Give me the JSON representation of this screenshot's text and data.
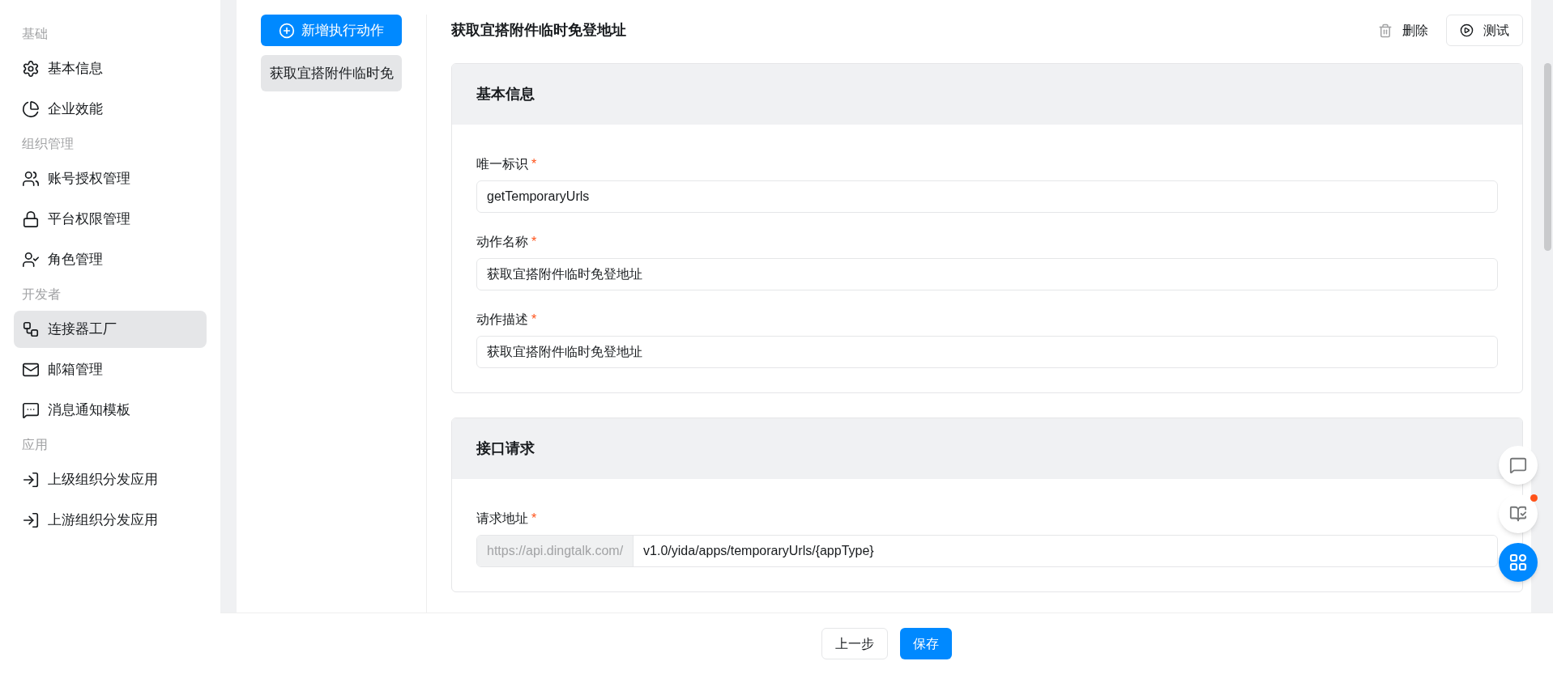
{
  "sidebar": {
    "groups": [
      {
        "heading": "基础",
        "items": [
          {
            "label": "基本信息",
            "selected": false
          },
          {
            "label": "企业效能",
            "selected": false
          }
        ]
      },
      {
        "heading": "组织管理",
        "items": [
          {
            "label": "账号授权管理",
            "selected": false
          },
          {
            "label": "平台权限管理",
            "selected": false
          },
          {
            "label": "角色管理",
            "selected": false
          }
        ]
      },
      {
        "heading": "开发者",
        "items": [
          {
            "label": "连接器工厂",
            "selected": true
          },
          {
            "label": "邮箱管理",
            "selected": false
          },
          {
            "label": "消息通知模板",
            "selected": false
          }
        ]
      },
      {
        "heading": "应用",
        "items": [
          {
            "label": "上级组织分发应用",
            "selected": false
          },
          {
            "label": "上游组织分发应用",
            "selected": false
          }
        ]
      }
    ]
  },
  "actions": {
    "add_button": "新增执行动作",
    "items": [
      {
        "label": "获取宜搭附件临时免",
        "selected": true
      }
    ]
  },
  "detail": {
    "title": "获取宜搭附件临时免登地址",
    "delete_button": "删除",
    "test_button": "测试",
    "sections": [
      {
        "title": "基本信息",
        "fields": [
          {
            "kind": "text",
            "label": "唯一标识",
            "required_mark": "*",
            "value": "getTemporaryUrls"
          },
          {
            "kind": "text",
            "label": "动作名称",
            "required_mark": "*",
            "value": "获取宜搭附件临时免登地址"
          },
          {
            "kind": "text",
            "label": "动作描述",
            "required_mark": "*",
            "value": "获取宜搭附件临时免登地址"
          }
        ]
      },
      {
        "title": "接口请求",
        "fields": [
          {
            "kind": "url",
            "label": "请求地址",
            "required_mark": "*",
            "prefix": "https://api.dingtalk.com/",
            "value": "v1.0/yida/apps/temporaryUrls/{appType}"
          }
        ]
      }
    ]
  },
  "footer": {
    "back_button": "上一步",
    "save_button": "保存"
  },
  "float_buttons": [
    {
      "kind": "chat",
      "badge": false
    },
    {
      "kind": "book",
      "badge": true
    },
    {
      "kind": "apps",
      "badge": false
    }
  ]
}
